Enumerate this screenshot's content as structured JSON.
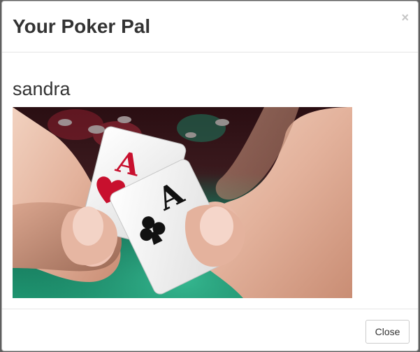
{
  "modal": {
    "title": "Your Poker Pal",
    "close_glyph": "×",
    "close_icon": "close-icon"
  },
  "body": {
    "player_name": "sandra",
    "photo_icon": "poker-aces-photo"
  },
  "footer": {
    "close_label": "Close"
  },
  "colors": {
    "felt": "#1f8a6a",
    "chip_red": "#a52a3a",
    "heart": "#c8102e",
    "backdrop": "#5f5f5f"
  }
}
